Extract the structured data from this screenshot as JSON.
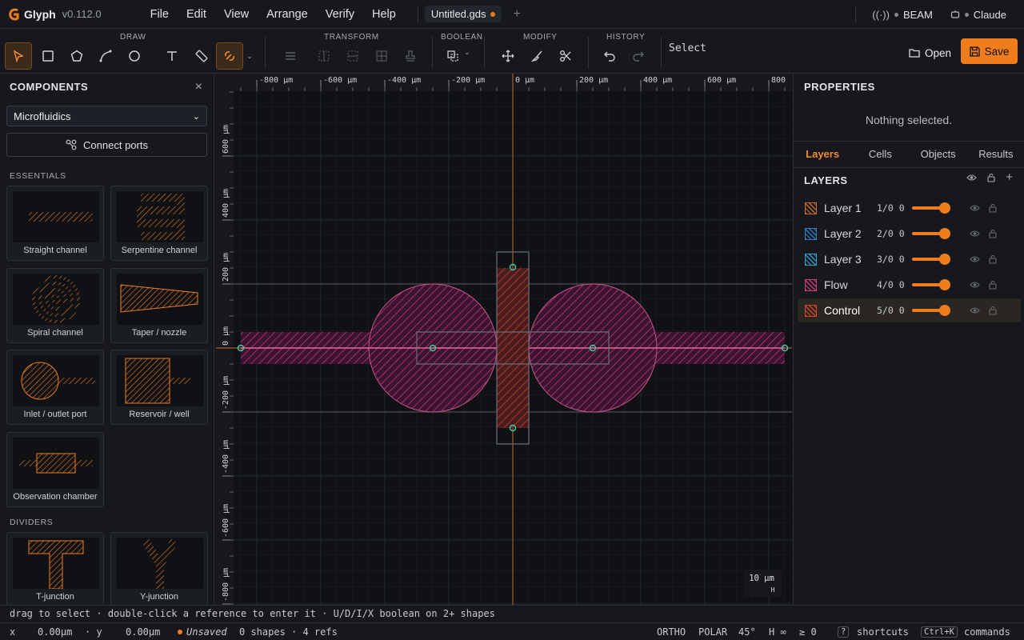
{
  "app": {
    "name": "Glyph",
    "version": "v0.112.0"
  },
  "menu": [
    "File",
    "Edit",
    "View",
    "Arrange",
    "Verify",
    "Help"
  ],
  "file_tab": {
    "name": "Untitled.gds",
    "modified": true
  },
  "integrations": [
    "BEAM",
    "Claude"
  ],
  "toolbar": {
    "groups": [
      "DRAW",
      "TRANSFORM",
      "BOOLEAN",
      "MODIFY",
      "HISTORY"
    ],
    "mode": "Select",
    "open_label": "Open",
    "save_label": "Save"
  },
  "components": {
    "title": "COMPONENTS",
    "library": "Microfluidics",
    "connect_label": "Connect ports",
    "essentials_label": "ESSENTIALS",
    "dividers_label": "DIVIDERS",
    "essentials": [
      "Straight channel",
      "Serpentine channel",
      "Spiral channel",
      "Taper / nozzle",
      "Inlet / outlet port",
      "Reservoir / well",
      "Observation chamber"
    ],
    "dividers": [
      "T-junction",
      "Y-junction"
    ]
  },
  "canvas": {
    "x_ticks": [
      "-800 µm",
      "-600 µm",
      "-400 µm",
      "-200 µm",
      "0 µm",
      "200 µm",
      "400 µm",
      "600 µm",
      "800"
    ],
    "y_ticks": [
      "600 µm",
      "400 µm",
      "200 µm",
      "0 µm",
      "-200 µm",
      "-400 µm",
      "-600 µm",
      "-800 µm"
    ],
    "scale_label": "10 µm",
    "scale_sub": "H"
  },
  "properties": {
    "title": "PROPERTIES",
    "empty_text": "Nothing selected.",
    "tabs": [
      "Layers",
      "Cells",
      "Objects",
      "Results"
    ],
    "active_tab": "Layers",
    "layers_title": "LAYERS"
  },
  "layers": [
    {
      "name": "Layer 1",
      "num": "1/0",
      "val": "0",
      "color": "#c8692a"
    },
    {
      "name": "Layer 2",
      "num": "2/0",
      "val": "0",
      "color": "#2a7fc8"
    },
    {
      "name": "Layer 3",
      "num": "3/0",
      "val": "0",
      "color": "#2a9fc8"
    },
    {
      "name": "Flow",
      "num": "4/0",
      "val": "0",
      "color": "#d23a7a"
    },
    {
      "name": "Control",
      "num": "5/0",
      "val": "0",
      "color": "#d8422a"
    }
  ],
  "hint": "drag to select · double-click a reference to enter it · U/D/I/X boolean on 2+ shapes",
  "status": {
    "x_label": "x",
    "x_val": "0.00µm",
    "y_label": "· y",
    "y_val": "0.00µm",
    "unsaved": "Unsaved",
    "counts": "0 shapes · 4 refs",
    "ortho": "ORTHO",
    "polar": "POLAR",
    "angle": "45°",
    "h": "H ∞",
    "g": "≥ 0",
    "q": "?",
    "shortcuts": "shortcuts",
    "kbd": "Ctrl+K",
    "commands": "commands"
  }
}
